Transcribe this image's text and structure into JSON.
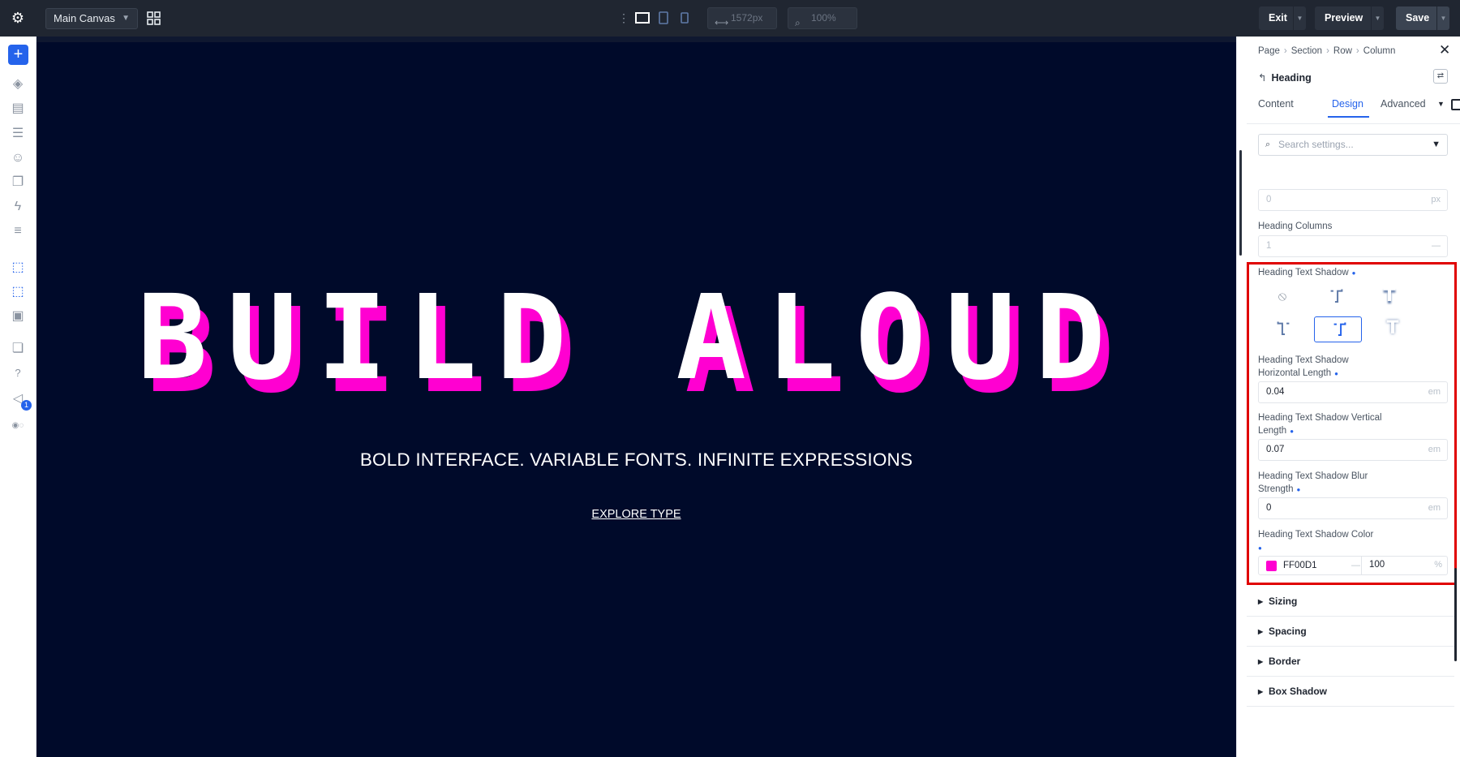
{
  "topbar": {
    "canvas_name": "Main Canvas",
    "width_value": "1572px",
    "zoom_value": "100%",
    "exit_label": "Exit",
    "preview_label": "Preview",
    "save_label": "Save"
  },
  "leftbar": {
    "notification_count": "1"
  },
  "stage": {
    "heading": "BUILD ALOUD",
    "subheading": "BOLD INTERFACE. VARIABLE FONTS. INFINITE EXPRESSIONS",
    "cta": "EXPLORE TYPE",
    "background_color": "#000a2a",
    "heading_color": "#ffffff",
    "shadow_color": "#ff00d1"
  },
  "panel": {
    "breadcrumb": [
      "Page",
      "Section",
      "Row",
      "Column"
    ],
    "module_title": "Heading",
    "tabs": [
      "Content",
      "Design",
      "Advanced"
    ],
    "active_tab": "Design",
    "search_placeholder": "Search settings...",
    "fields": {
      "prev_value": "0",
      "prev_unit": "px",
      "heading_columns_label": "Heading Columns",
      "heading_columns_value": "1",
      "text_shadow_label": "Heading Text Shadow",
      "h_length_label_1": "Heading Text Shadow",
      "h_length_label_2": "Horizontal Length",
      "h_length_value": "0.04",
      "v_length_label_1": "Heading Text Shadow Vertical",
      "v_length_label_2": "Length",
      "v_length_value": "0.07",
      "blur_label_1": "Heading Text Shadow Blur",
      "blur_label_2": "Strength",
      "blur_value": "0",
      "color_label": "Heading Text Shadow Color",
      "color_hex": "FF00D1",
      "color_alpha": "100",
      "unit_em": "em",
      "unit_pct": "%"
    },
    "sections": [
      "Sizing",
      "Spacing",
      "Border",
      "Box Shadow"
    ]
  }
}
